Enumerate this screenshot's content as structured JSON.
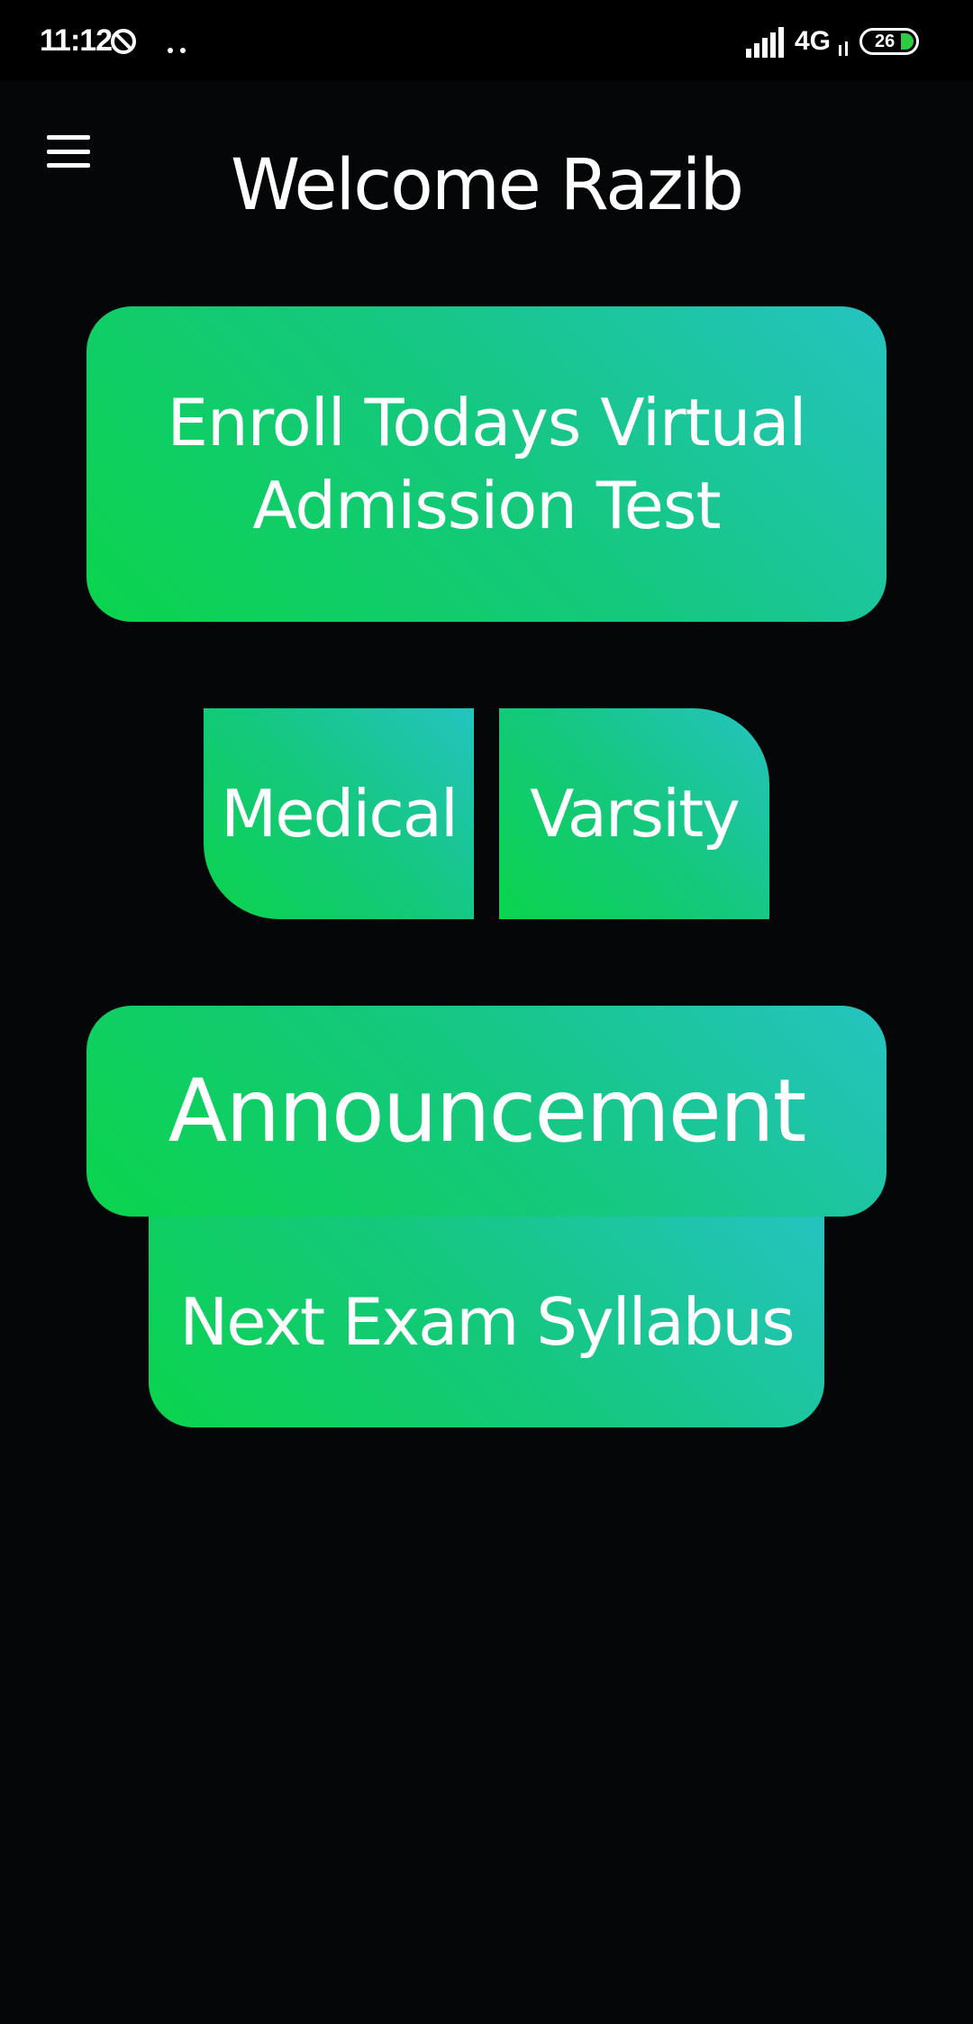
{
  "status_bar": {
    "time": "11:12",
    "app_icon": "circle-slash-icon",
    "notification_dots": "more-notifications-icon",
    "signal_icon": "signal-bars-icon",
    "network": "4G",
    "battery_level": "26",
    "battery_color": "#2ecc40"
  },
  "header": {
    "menu_icon": "hamburger-menu-icon",
    "title": "Welcome Razib"
  },
  "tiles": {
    "enroll": "Enroll Todays Virtual Admission Test",
    "medical": "Medical",
    "varsity": "Varsity",
    "announcement": "Announcement",
    "syllabus": "Next Exam Syllabus"
  },
  "colors": {
    "background": "#040608",
    "tile_gradient_start": "#0bd44c",
    "tile_gradient_end": "#25c3c0",
    "text": "#ffffff"
  }
}
